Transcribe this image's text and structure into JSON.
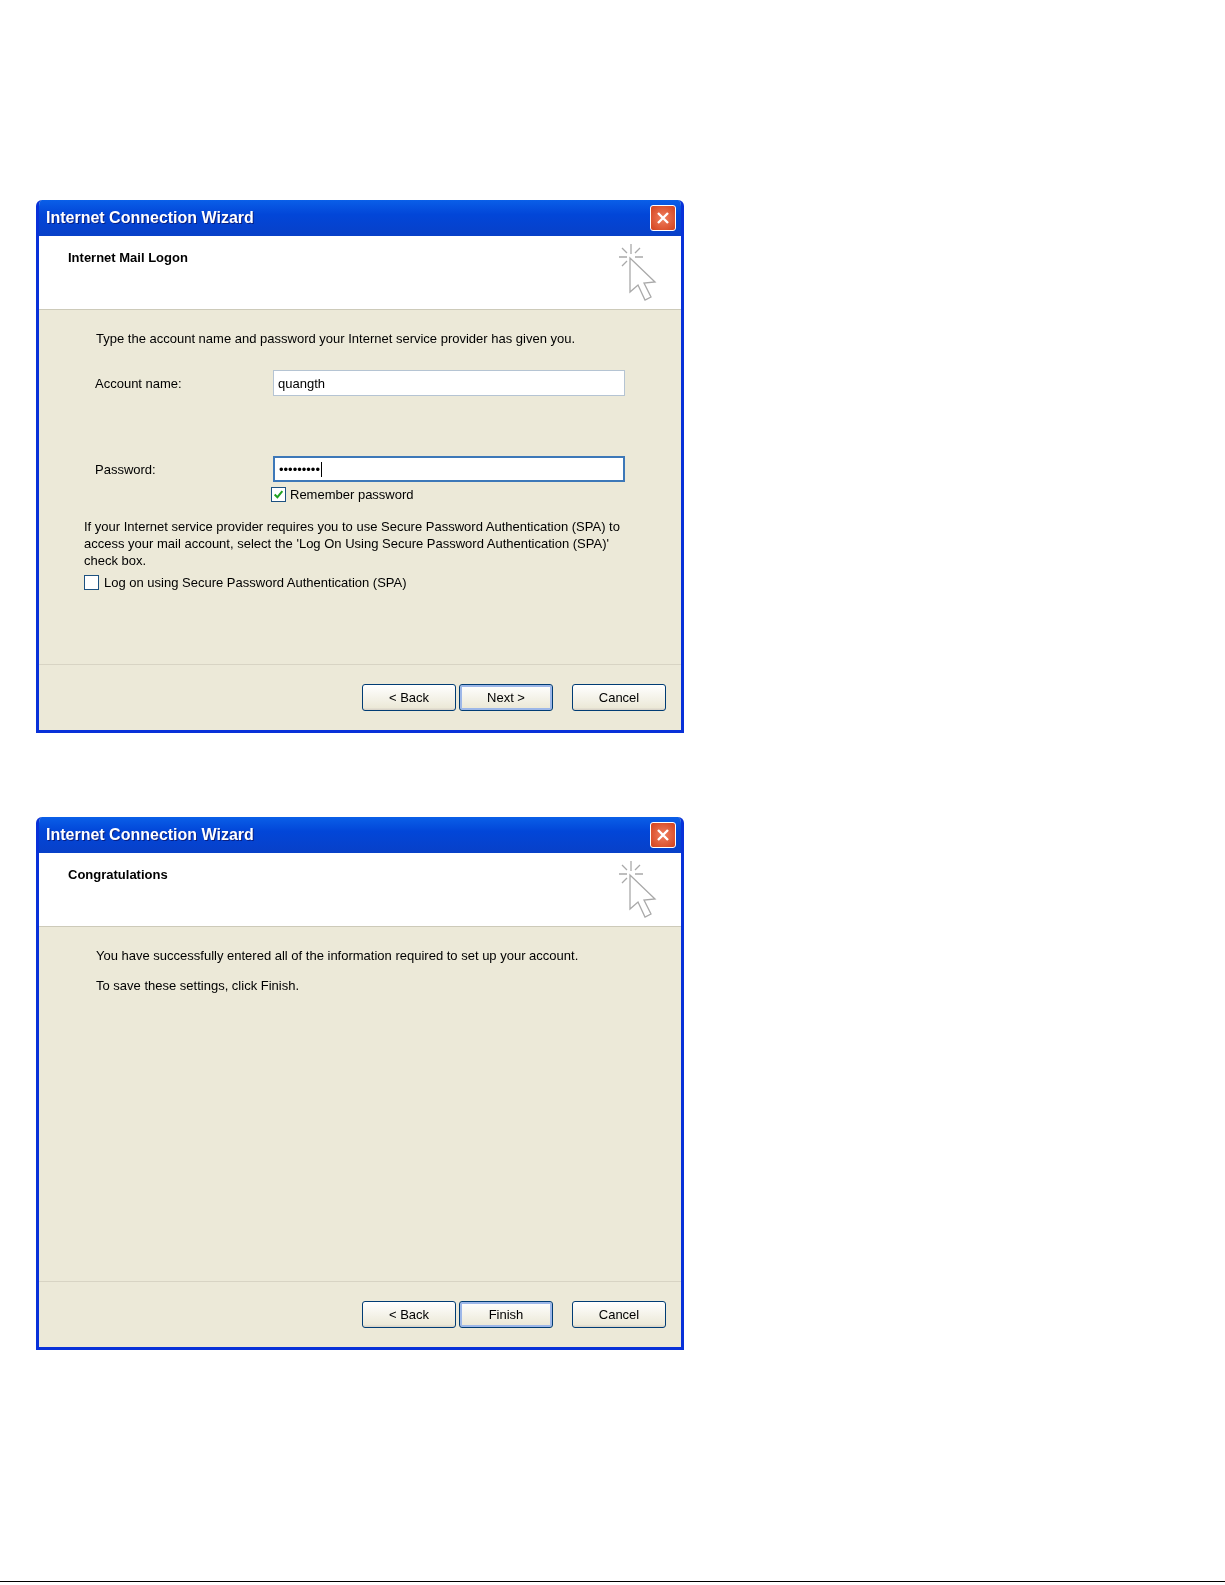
{
  "dialogs": [
    {
      "title": "Internet Connection Wizard",
      "header": "Internet Mail Logon",
      "content": [
        {
          "kind": "text",
          "text": "Type the account name and password your Internet service provider has given you."
        },
        {
          "kind": "field",
          "label": "Account name:",
          "value": "quangth",
          "focused": false
        },
        {
          "kind": "field",
          "label": "Password:",
          "value": "•••••••••",
          "focused": true,
          "option": {
            "label": "Remember password",
            "checked": true
          }
        },
        {
          "kind": "note",
          "text": "If your Internet service provider requires you to use Secure Password Authentication (SPA) to access your mail account, select the 'Log On Using Secure Password Authentication (SPA)' check box."
        },
        {
          "kind": "checkbox",
          "label": "Log on using Secure Password Authentication (SPA)",
          "checked": false
        }
      ],
      "buttons": [
        {
          "label": "< Back",
          "default": false
        },
        {
          "label": "Next >",
          "default": true
        },
        {
          "label": "Cancel",
          "default": false
        }
      ]
    },
    {
      "title": "Internet Connection Wizard",
      "header": "Congratulations",
      "content": [
        {
          "kind": "text",
          "text": "You have successfully entered all of the information required to set up your account."
        },
        {
          "kind": "text",
          "text": "To save these settings, click Finish."
        }
      ],
      "buttons": [
        {
          "label": "< Back",
          "default": false
        },
        {
          "label": "Finish",
          "default": true
        },
        {
          "label": "Cancel",
          "default": false
        }
      ]
    }
  ]
}
